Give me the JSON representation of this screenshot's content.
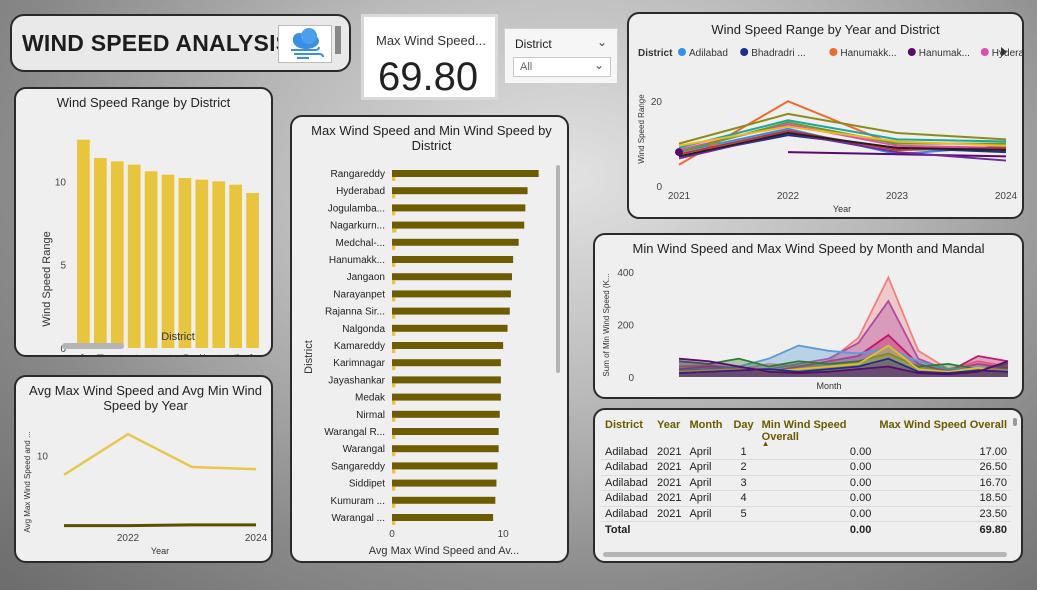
{
  "header": {
    "title": "WIND SPEED ANALYSIS",
    "logo_icon": "cloud-wind-icon"
  },
  "kpi": {
    "label": "Max Wind Speed...",
    "value": "69.80"
  },
  "slicer": {
    "title": "District",
    "value": "All"
  },
  "colors": {
    "bar_yellow": "#e8c53a",
    "bar_olive": "#6e5d00",
    "line_yellow": "#e6c84c",
    "line_dark": "#5e4f00"
  },
  "charts": {
    "range_by_district": {
      "title": "Wind Speed Range by District",
      "xlabel": "District",
      "ylabel": "Wind Speed Range",
      "yticks": [
        "0",
        "5",
        "10"
      ]
    },
    "max_min_by_district": {
      "title": "Max Wind Speed and Min Wind Speed by District",
      "xlabel": "Avg Max Wind Speed and Av...",
      "ylabel": "District",
      "xticks": [
        "0",
        "10"
      ]
    },
    "avg_by_year": {
      "title": "Avg Max Wind Speed and Avg Min Wind Speed by Year",
      "xlabel": "Year",
      "ylabel": "Avg Max Wind Speed and ...",
      "yticks": [
        "10"
      ],
      "xticks": [
        "2022",
        "2024"
      ]
    },
    "range_by_year_district": {
      "title": "Wind Speed Range by Year and District",
      "legend_title": "District",
      "legend": [
        "Adilabad",
        "Bhadradri ...",
        "Hanumakk...",
        "Hanumak...",
        "Hyderabad"
      ],
      "legend_colors": [
        "#2f8ff0",
        "#1c2f8c",
        "#ee6a2a",
        "#5a0a6e",
        "#e04fb0"
      ],
      "xlabel": "Year",
      "ylabel": "Wind Speed Range",
      "yticks": [
        "0",
        "20"
      ],
      "xticks": [
        "2021",
        "2022",
        "2023",
        "2024"
      ]
    },
    "month_mandal": {
      "title": "Min Wind Speed and Max Wind Speed by Month and Mandal",
      "xlabel": "Month",
      "ylabel": "Sum of Min Wind Speed (K...",
      "yticks": [
        "0",
        "200",
        "400"
      ]
    }
  },
  "chart_data": [
    {
      "type": "bar",
      "title": "Wind Speed Range by District",
      "xlabel": "District",
      "ylabel": "Wind Speed Range",
      "categories": [
        "Rangareddy",
        "Hyderabad",
        "Jogulamba...",
        "Nagarkurn...",
        "Medchal-...",
        "Hanumakk...",
        "Jangaon",
        "Narayanpet",
        "Rajanna Sir...",
        "Nalgonda",
        "Kamareddy"
      ],
      "values": [
        12.5,
        11.4,
        11.2,
        11.0,
        10.6,
        10.4,
        10.2,
        10.1,
        10.0,
        9.8,
        9.3
      ],
      "ylim": [
        0,
        13.5
      ],
      "grid": false
    },
    {
      "type": "bar",
      "orientation": "horizontal",
      "title": "Max Wind Speed and Min Wind Speed by District",
      "xlabel": "Avg Max Wind Speed and Av...",
      "ylabel": "District",
      "categories": [
        "Rangareddy",
        "Hyderabad",
        "Jogulamba...",
        "Nagarkurn...",
        "Medchal-...",
        "Hanumakk...",
        "Jangaon",
        "Narayanpet",
        "Rajanna Sir...",
        "Nalgonda",
        "Kamareddy",
        "Karimnagar",
        "Jayashankar",
        "Medak",
        "Nirmal",
        "Warangal R...",
        "Warangal",
        "Sangareddy",
        "Siddipet",
        "Kumuram ...",
        "Warangal ..."
      ],
      "series": [
        {
          "values": [
            13.2,
            12.2,
            12.0,
            11.9,
            11.4,
            10.9,
            10.8,
            10.7,
            10.6,
            10.4,
            10.0,
            9.8,
            9.8,
            9.8,
            9.7,
            9.6,
            9.6,
            9.5,
            9.4,
            9.3,
            9.1
          ]
        },
        {
          "values": [
            0.3,
            0.3,
            0.3,
            0.4,
            0.3,
            0.3,
            0.3,
            0.3,
            0.3,
            0.3,
            0.3,
            0.3,
            0.3,
            0.3,
            0.3,
            0.3,
            0.3,
            0.3,
            0.3,
            0.3,
            0.3
          ]
        }
      ],
      "xlim": [
        0,
        13.5
      ]
    },
    {
      "type": "line",
      "title": "Avg Max Wind Speed and Avg Min Wind Speed by Year",
      "xlabel": "Year",
      "ylabel": "Avg Max Wind Speed and ...",
      "x": [
        2021,
        2022,
        2023,
        2024
      ],
      "series": [
        {
          "values": [
            7.3,
            13.0,
            8.4,
            8.1
          ]
        },
        {
          "values": [
            0.2,
            0.2,
            0.3,
            0.3
          ]
        }
      ],
      "ylim": [
        0,
        14
      ]
    },
    {
      "type": "line",
      "title": "Wind Speed Range by Year and District",
      "xlabel": "Year",
      "ylabel": "Wind Speed Range",
      "x": [
        2021,
        2022,
        2023,
        2024
      ],
      "series": [
        {
          "name": "Adilabad",
          "color": "#2f8ff0",
          "values": [
            8.0,
            13.5,
            7.5,
            9.5
          ]
        },
        {
          "name": "Bhadradri ...",
          "color": "#1c2f8c",
          "values": [
            7.0,
            12.0,
            9.0,
            8.0
          ]
        },
        {
          "name": "Hanumakk...",
          "color": "#ee6a2a",
          "values": [
            5.0,
            20.0,
            9.5,
            8.5
          ]
        },
        {
          "name": "Hanumak...",
          "color": "#5a0a6e",
          "values": [
            null,
            8.0,
            7.5,
            7.0
          ]
        },
        {
          "name": "Hyderabad",
          "color": "#e04fb0",
          "values": [
            8.5,
            14.5,
            9.5,
            9.0
          ]
        },
        {
          "color": "#8b8b1a",
          "values": [
            10.0,
            17.0,
            12.5,
            11.0
          ]
        },
        {
          "color": "#1aa5a0",
          "values": [
            9.0,
            15.5,
            11.0,
            10.5
          ]
        },
        {
          "color": "#6a9a2a",
          "values": [
            8.0,
            15.0,
            10.0,
            10.0
          ]
        },
        {
          "color": "#c23030",
          "values": [
            7.5,
            13.0,
            8.5,
            9.0
          ]
        },
        {
          "color": "#6e2a9e",
          "values": [
            6.5,
            12.5,
            8.0,
            6.0
          ]
        },
        {
          "color": "#222222",
          "values": [
            7.0,
            12.5,
            9.0,
            8.5
          ]
        },
        {
          "color": "#f0b81a",
          "values": [
            9.5,
            14.0,
            10.5,
            9.5
          ]
        }
      ],
      "ylim": [
        0,
        25
      ]
    },
    {
      "type": "area",
      "title": "Min Wind Speed and Max Wind Speed by Month and Mandal",
      "xlabel": "Month",
      "ylabel": "Sum of Min Wind Speed (K...",
      "x": [
        1,
        2,
        3,
        4,
        5,
        6,
        7,
        8,
        9,
        10,
        11,
        12
      ],
      "series": [
        {
          "color": "#f08080",
          "values": [
            40,
            45,
            30,
            50,
            40,
            60,
            150,
            380,
            100,
            30,
            60,
            40
          ]
        },
        {
          "color": "#b04aa0",
          "values": [
            30,
            40,
            35,
            30,
            50,
            70,
            130,
            290,
            70,
            25,
            50,
            35
          ]
        },
        {
          "color": "#c0186a",
          "values": [
            20,
            30,
            25,
            20,
            40,
            60,
            80,
            160,
            50,
            20,
            80,
            60
          ]
        },
        {
          "color": "#5b9bd5",
          "values": [
            25,
            30,
            40,
            70,
            120,
            100,
            90,
            110,
            60,
            30,
            40,
            30
          ]
        },
        {
          "color": "#2e7d32",
          "values": [
            60,
            50,
            70,
            40,
            60,
            50,
            60,
            90,
            40,
            50,
            30,
            50
          ]
        },
        {
          "color": "#e0c020",
          "values": [
            20,
            25,
            30,
            20,
            30,
            40,
            50,
            120,
            30,
            20,
            35,
            25
          ]
        },
        {
          "color": "#1c2f8c",
          "values": [
            15,
            20,
            25,
            30,
            20,
            30,
            40,
            70,
            20,
            15,
            25,
            20
          ]
        },
        {
          "color": "#5a0a6e",
          "values": [
            70,
            60,
            40,
            20,
            15,
            20,
            30,
            40,
            15,
            10,
            20,
            60
          ]
        }
      ],
      "ylim": [
        0,
        420
      ]
    }
  ],
  "table": {
    "columns": [
      "District",
      "Year",
      "Month",
      "Day",
      "Min Wind Speed Overall",
      "Max Wind Speed Overall"
    ],
    "rows": [
      [
        "Adilabad",
        "2021",
        "April",
        "1",
        "0.00",
        "17.00"
      ],
      [
        "Adilabad",
        "2021",
        "April",
        "2",
        "0.00",
        "26.50"
      ],
      [
        "Adilabad",
        "2021",
        "April",
        "3",
        "0.00",
        "16.70"
      ],
      [
        "Adilabad",
        "2021",
        "April",
        "4",
        "0.00",
        "18.50"
      ],
      [
        "Adilabad",
        "2021",
        "April",
        "5",
        "0.00",
        "23.50"
      ]
    ],
    "total": [
      "Total",
      "",
      "",
      "",
      "0.00",
      "69.80"
    ]
  }
}
